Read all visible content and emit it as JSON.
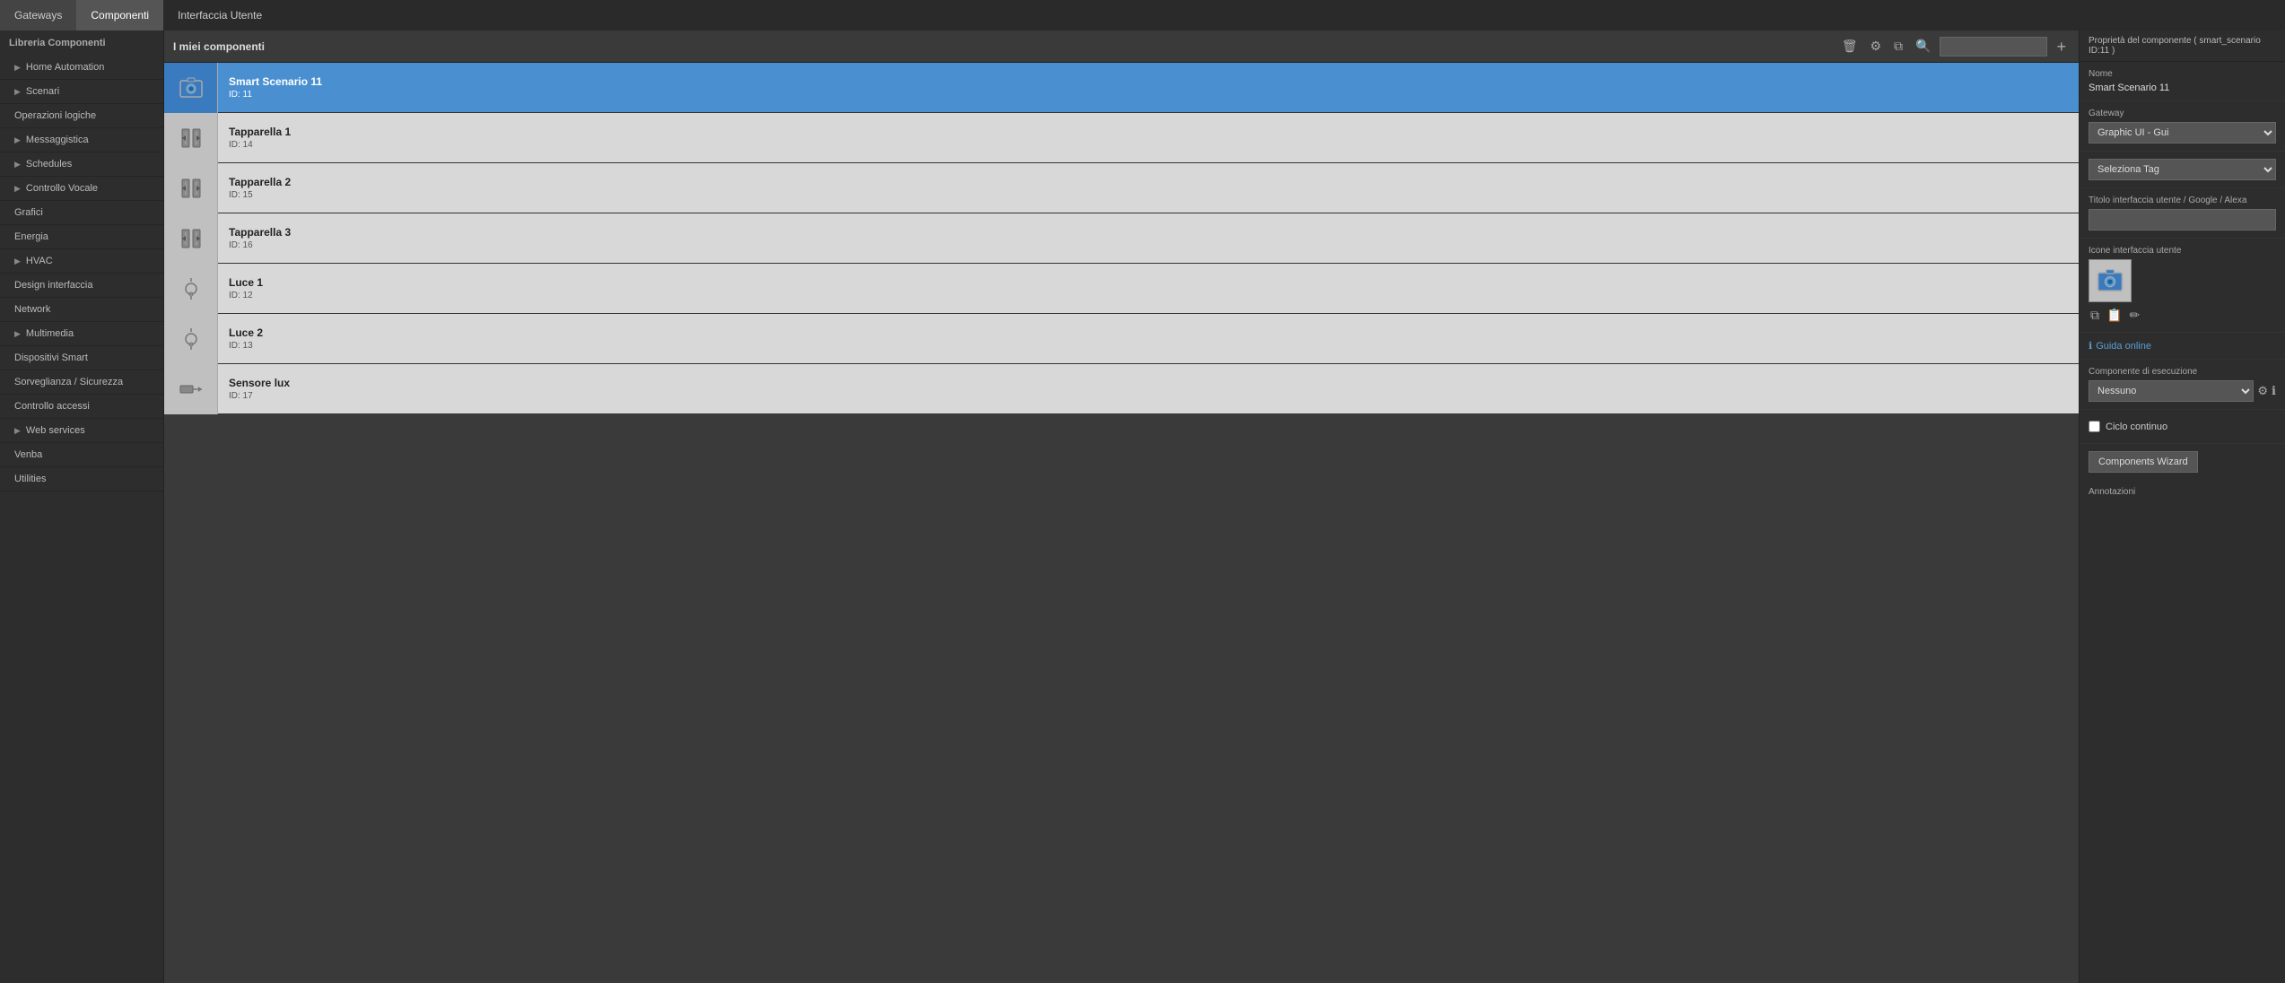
{
  "topNav": {
    "items": [
      {
        "label": "Gateways",
        "active": false
      },
      {
        "label": "Componenti",
        "active": true
      },
      {
        "label": "Interfaccia Utente",
        "active": false
      }
    ]
  },
  "sidebar": {
    "header": "Libreria Componenti",
    "items": [
      {
        "label": "Home Automation",
        "hasArrow": true
      },
      {
        "label": "Scenari",
        "hasArrow": true
      },
      {
        "label": "Operazioni logiche",
        "hasArrow": false
      },
      {
        "label": "Messaggistica",
        "hasArrow": true
      },
      {
        "label": "Schedules",
        "hasArrow": true
      },
      {
        "label": "Controllo Vocale",
        "hasArrow": true
      },
      {
        "label": "Grafici",
        "hasArrow": false
      },
      {
        "label": "Energia",
        "hasArrow": false
      },
      {
        "label": "HVAC",
        "hasArrow": true
      },
      {
        "label": "Design interfaccia",
        "hasArrow": false
      },
      {
        "label": "Network",
        "hasArrow": false
      },
      {
        "label": "Multimedia",
        "hasArrow": true
      },
      {
        "label": "Dispositivi Smart",
        "hasArrow": false
      },
      {
        "label": "Sorveglianza / Sicurezza",
        "hasArrow": false
      },
      {
        "label": "Controllo accessi",
        "hasArrow": false
      },
      {
        "label": "Web services",
        "hasArrow": true
      },
      {
        "label": "Venba",
        "hasArrow": false
      },
      {
        "label": "Utilities",
        "hasArrow": false
      }
    ]
  },
  "componentList": {
    "title": "I miei componenti",
    "searchPlaceholder": "",
    "components": [
      {
        "name": "Smart Scenario 11",
        "id": "ID: 11",
        "iconType": "camera",
        "selected": true
      },
      {
        "name": "Tapparella 1",
        "id": "ID: 14",
        "iconType": "blind",
        "selected": false
      },
      {
        "name": "Tapparella 2",
        "id": "ID: 15",
        "iconType": "blind",
        "selected": false
      },
      {
        "name": "Tapparella 3",
        "id": "ID: 16",
        "iconType": "blind",
        "selected": false
      },
      {
        "name": "Luce 1",
        "id": "ID: 12",
        "iconType": "light",
        "selected": false
      },
      {
        "name": "Luce 2",
        "id": "ID: 13",
        "iconType": "light",
        "selected": false
      },
      {
        "name": "Sensore lux",
        "id": "ID: 17",
        "iconType": "sensor",
        "selected": false
      }
    ]
  },
  "rightPanel": {
    "title": "Proprietà del componente ( smart_scenario ID:11 )",
    "nomLabel": "Nome",
    "nomValue": "Smart Scenario 11",
    "gatewayLabel": "Gateway",
    "gatewayValue": "Graphic UI - Gui",
    "tagLabel": "Seleziona Tag",
    "tagPlaceholder": "",
    "titoloLabel": "Titolo interfaccia utente / Google / Alexa",
    "iconeLabel": "Icone interfaccia utente",
    "guidaLabel": "Guida online",
    "componenteLabel": "Componente di esecuzione",
    "componenteValue": "Nessuno",
    "cicloLabel": "Ciclo continuo",
    "wizardLabel": "Components Wizard",
    "annotazioniLabel": "Annotazioni"
  }
}
